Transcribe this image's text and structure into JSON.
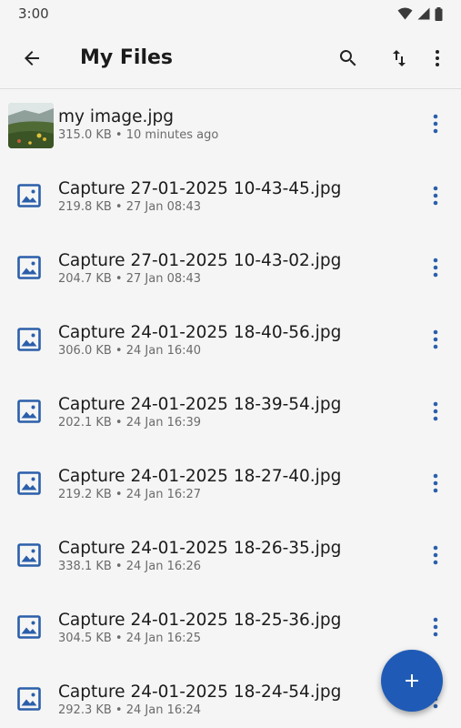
{
  "status_bar": {
    "time": "3:00"
  },
  "app_bar": {
    "title": "My Files",
    "icons": [
      "arrow-back-icon",
      "search-icon",
      "sort-icon",
      "more-vert-icon"
    ]
  },
  "colors": {
    "accent": "#1f5bb6",
    "icon_blue": "#2b5faa",
    "text_secondary": "#6b6b6b"
  },
  "files": [
    {
      "name": "my image.jpg",
      "meta": "315.0 KB • 10 minutes ago",
      "icon": "photo-thumbnail"
    },
    {
      "name": "Capture 27-01-2025 10-43-45.jpg",
      "meta": "219.8 KB • 27 Jan 08:43",
      "icon": "image-file-icon"
    },
    {
      "name": "Capture 27-01-2025 10-43-02.jpg",
      "meta": "204.7 KB • 27 Jan 08:43",
      "icon": "image-file-icon"
    },
    {
      "name": "Capture 24-01-2025 18-40-56.jpg",
      "meta": "306.0 KB • 24 Jan 16:40",
      "icon": "image-file-icon"
    },
    {
      "name": "Capture 24-01-2025 18-39-54.jpg",
      "meta": "202.1 KB • 24 Jan 16:39",
      "icon": "image-file-icon"
    },
    {
      "name": "Capture 24-01-2025 18-27-40.jpg",
      "meta": "219.2 KB • 24 Jan 16:27",
      "icon": "image-file-icon"
    },
    {
      "name": "Capture 24-01-2025 18-26-35.jpg",
      "meta": "338.1 KB • 24 Jan 16:26",
      "icon": "image-file-icon"
    },
    {
      "name": "Capture 24-01-2025 18-25-36.jpg",
      "meta": "304.5 KB • 24 Jan 16:25",
      "icon": "image-file-icon"
    },
    {
      "name": "Capture 24-01-2025 18-24-54.jpg",
      "meta": "292.3 KB • 24 Jan 16:24",
      "icon": "image-file-icon"
    }
  ],
  "fab": {
    "icon": "add-icon"
  }
}
